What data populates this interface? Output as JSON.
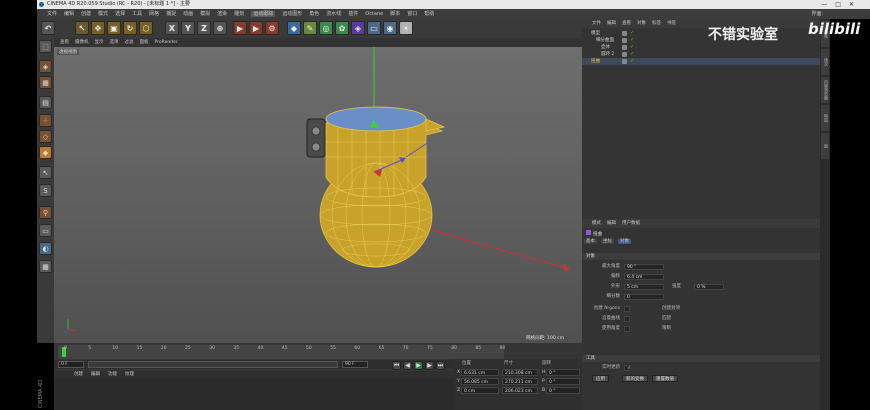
{
  "window": {
    "title": "CINEMA 4D R20.059 Studio (RC - R20) - [未标题 1 *] - 主要",
    "controls": [
      "—",
      "□",
      "✕"
    ]
  },
  "menubar": {
    "items": [
      "文件",
      "编辑",
      "创建",
      "模式",
      "选择",
      "工具",
      "网格",
      "捕捉",
      "动画",
      "模拟",
      "渲染",
      "雕刻",
      "运动跟踪",
      "运动图形",
      "角色",
      "流水线",
      "插件",
      "Octane",
      "脚本",
      "窗口",
      "帮助"
    ],
    "layout_label": "界面:"
  },
  "toolbar": {
    "axis_x": "X",
    "axis_y": "Y",
    "axis_z": "Z"
  },
  "viewport": {
    "menu": [
      "查看",
      "摄像机",
      "显示",
      "选项",
      "过滤",
      "面板",
      "ProRender"
    ],
    "label": "透视视图",
    "grid_info": "网格间距: 100 cm"
  },
  "timeline": {
    "ruler": [
      "0",
      "5",
      "10",
      "15",
      "20",
      "25",
      "30",
      "35",
      "40",
      "45",
      "50",
      "55",
      "60",
      "65",
      "70",
      "75",
      "80",
      "85",
      "90"
    ],
    "start_field": "0 F",
    "end_field": "90 F",
    "current_frame": "0 F"
  },
  "material_manager": {
    "tabs": [
      "创建",
      "编辑",
      "功能",
      "纹理"
    ]
  },
  "coordinates": {
    "headers": [
      "位置",
      "尺寸",
      "旋转"
    ],
    "rows": [
      {
        "axis": "X",
        "pos": "6.631 cm",
        "size": "210.308 cm",
        "rot_label": "H",
        "rot": "0 °"
      },
      {
        "axis": "Y",
        "pos": "56.085 cm",
        "size": "270.211 cm",
        "rot_label": "P",
        "rot": "0 °"
      },
      {
        "axis": "Z",
        "pos": "0 cm",
        "size": "206.023 cm",
        "rot_label": "B",
        "rot": "0 °"
      }
    ]
  },
  "object_manager": {
    "menu": [
      "文件",
      "编辑",
      "查看",
      "对象",
      "标签",
      "书签"
    ],
    "items": [
      {
        "name": "模型",
        "indent": 0,
        "selected": false
      },
      {
        "name": "细分曲面",
        "indent": 1,
        "selected": false
      },
      {
        "name": "壶体",
        "indent": 2,
        "selected": false
      },
      {
        "name": "圆环 2",
        "indent": 2,
        "selected": false
      },
      {
        "name": "扭曲",
        "indent": 0,
        "selected": true
      }
    ]
  },
  "attributes": {
    "menu": [
      "模式",
      "编辑",
      "用户数据"
    ],
    "object_label": "扭曲",
    "tabs": [
      "基本",
      "坐标",
      "对象"
    ],
    "section_object": "对象",
    "fields": [
      {
        "label": "最大角度",
        "value": "90 °",
        "label2": "",
        "value2": ""
      },
      {
        "label": "偏移",
        "value": "6.4 cm",
        "label2": "",
        "value2": ""
      },
      {
        "label": "外形",
        "value": "5 cm",
        "label2": "强度",
        "value2": "0 %"
      },
      {
        "label": "细分数",
        "value": "0",
        "label2": "",
        "value2": ""
      }
    ],
    "checkboxes": [
      {
        "label": "创建 N-gons",
        "label2": "创建封顶"
      },
      {
        "label": "沿着曲线",
        "label2": "匹配"
      },
      {
        "label": "使用角度",
        "label2": "限制"
      }
    ],
    "section_tool": "工具",
    "realtime_label": "实时更新",
    "buttons": [
      "应用",
      "新的变换",
      "重置数值"
    ]
  },
  "side_tabs": [
    "对象",
    "场次",
    "内容浏览器",
    "构造",
    "层"
  ],
  "watermark": {
    "text": "不错实验室",
    "brand": "bilibili"
  },
  "vertical_brand": "CINEMA 4D"
}
